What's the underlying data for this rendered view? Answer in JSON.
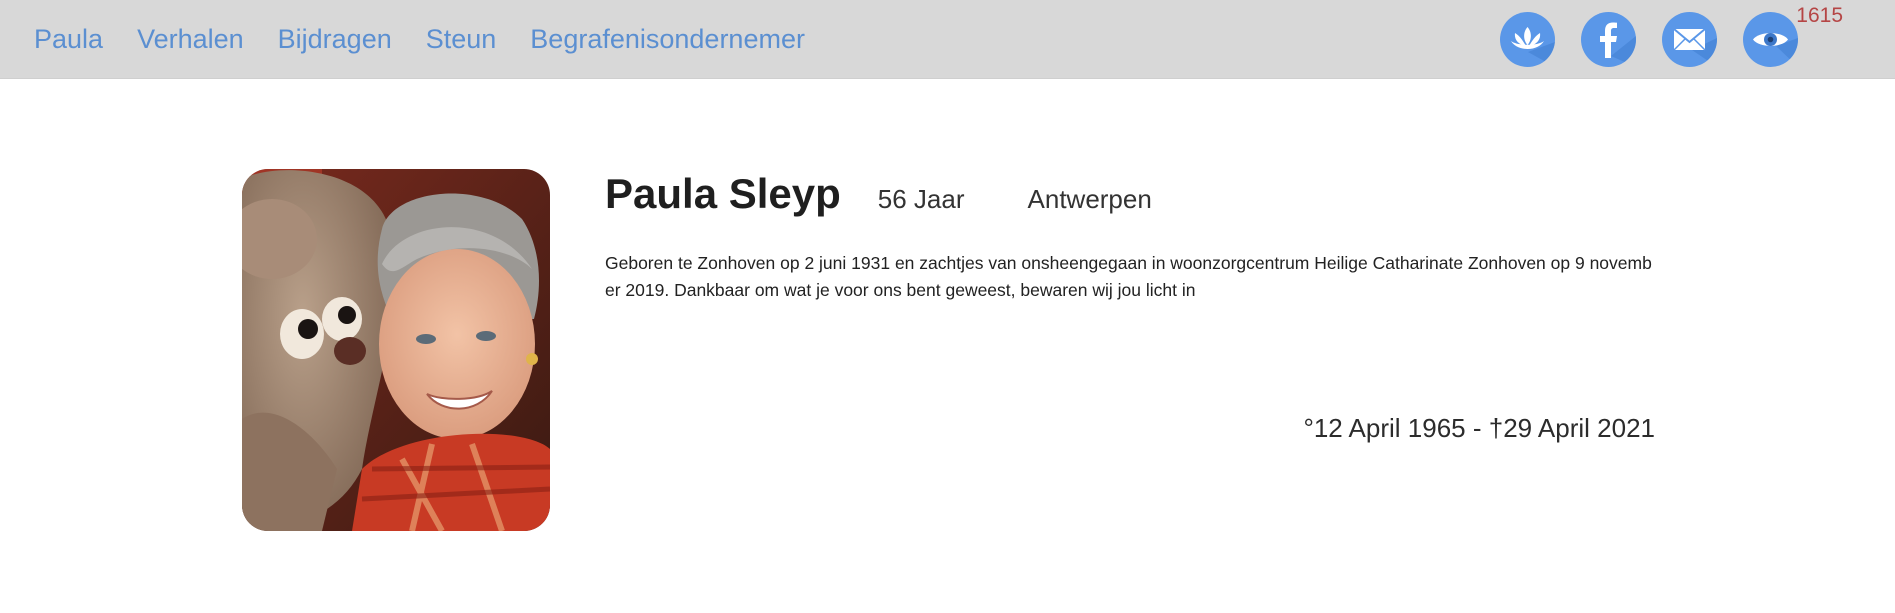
{
  "nav": {
    "links": [
      "Paula",
      "Verhalen",
      "Bijdragen",
      "Steun",
      "Begrafenisondernemer"
    ],
    "view_count": "1615",
    "icons": [
      "lotus-icon",
      "facebook-icon",
      "mail-icon",
      "eye-icon"
    ],
    "accent_color": "#5b8fd1",
    "icon_bg_color": "#5a97e8"
  },
  "profile": {
    "name": "Paula Sleyp",
    "age": "56 Jaar",
    "city": "Antwerpen",
    "bio": "Geboren te Zonhoven op 2 juni 1931 en zachtjes van onsheengegaan in woonzorgcentrum Heilige Catharinate Zonhoven op 9 november 2019. Dankbaar om wat je voor ons bent geweest, bewaren wij jou licht in",
    "dates": "°12 April 1965 - †29 April 2021"
  }
}
